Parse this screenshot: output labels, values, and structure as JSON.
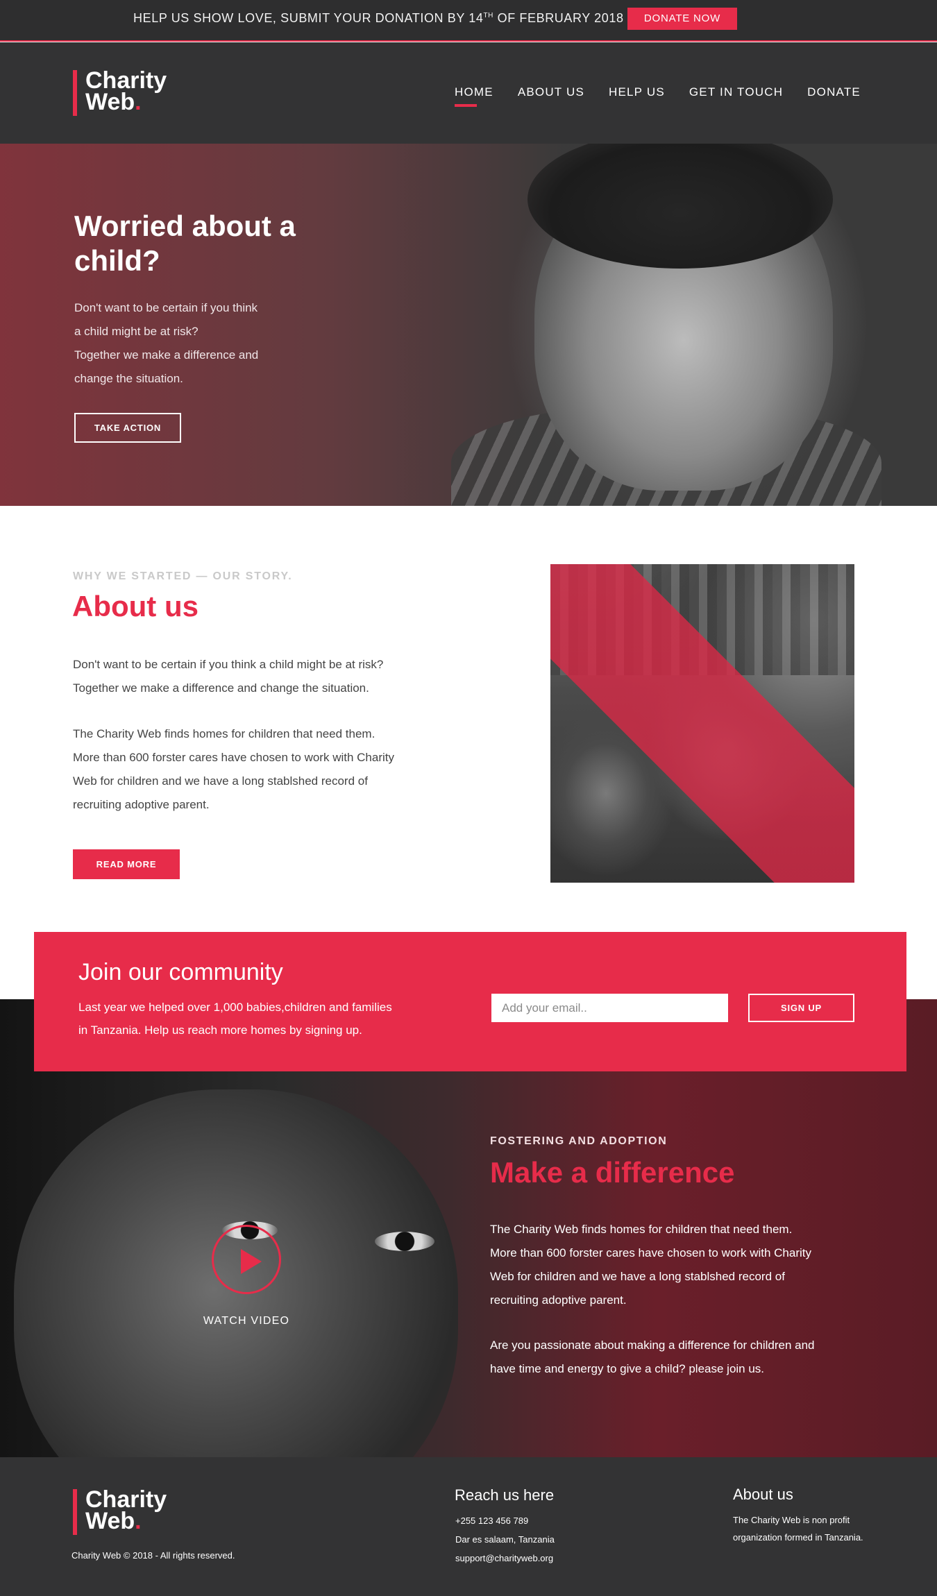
{
  "topbar": {
    "message_prefix": "HELP US SHOW LOVE, SUBMIT YOUR DONATION BY 14",
    "message_sup": "TH",
    "message_suffix": " OF FEBRUARY 2018",
    "donate_button": "DONATE NOW"
  },
  "brand": {
    "line1": "Charity",
    "line2": "Web",
    "dot": ".",
    "accent_color": "#e72c4a"
  },
  "nav": {
    "items": [
      "HOME",
      "ABOUT US",
      "HELP US",
      "GET IN TOUCH",
      "DONATE"
    ],
    "active": "HOME"
  },
  "hero": {
    "title": "Worried about a child?",
    "text": "Don't want to be certain if you think\na child might be at risk?\nTogether we make a difference and\nchange the situation.",
    "button": "TAKE ACTION"
  },
  "about": {
    "kicker": "WHY WE STARTED  — OUR STORY.",
    "title": "About us",
    "paragraph1": "Don't want to be certain if you think a child might be at risk?\nTogether we make a difference and change the situation.",
    "paragraph2": "The Charity Web finds homes for children  that need them.\nMore than 600 forster cares have chosen to work with Charity\nWeb for children and we have a long stablshed record of\nrecruiting adoptive parent.",
    "button": "READ MORE"
  },
  "community": {
    "title": "Join our community",
    "text": "Last year we helped over 1,000 babies,children and families\nin Tanzania. Help us reach more homes by signing up.",
    "email_placeholder": "Add your email..",
    "button": "SIGN UP"
  },
  "difference": {
    "kicker": "FOSTERING AND ADOPTION",
    "title": "Make a difference",
    "paragraph1": "The Charity Web finds homes for children that need them.\nMore than 600 forster cares have chosen to work with Charity\nWeb for children and we have a long stablshed record of\nrecruiting adoptive parent.",
    "paragraph2": "Are you passionate about making a  difference for children and\nhave time and energy to give a child? please join us.",
    "watch_label": "WATCH VIDEO",
    "play_icon": "play-icon"
  },
  "footer": {
    "copyright": "Charity Web © 2018 - All rights reserved.",
    "reach": {
      "title": "Reach us here",
      "phone": "+255 123 456 789",
      "address": "Dar es salaam, Tanzania",
      "email": "support@charityweb.org"
    },
    "about": {
      "title": "About us",
      "text": "The Charity Web is non profit\norganization formed in Tanzania."
    }
  }
}
